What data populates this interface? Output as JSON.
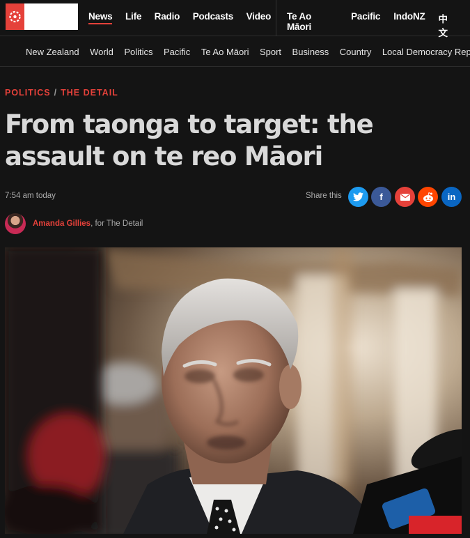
{
  "primary_nav": [
    {
      "label": "News"
    },
    {
      "label": "Life"
    },
    {
      "label": "Radio"
    },
    {
      "label": "Podcasts"
    },
    {
      "label": "Video"
    }
  ],
  "secondary_nav": [
    {
      "label": "Te Ao Māori"
    },
    {
      "label": "Pacific"
    },
    {
      "label": "IndoNZ"
    },
    {
      "label": "中文"
    }
  ],
  "section_nav": [
    {
      "label": "New Zealand"
    },
    {
      "label": "World"
    },
    {
      "label": "Politics"
    },
    {
      "label": "Pacific"
    },
    {
      "label": "Te Ao Māori"
    },
    {
      "label": "Sport"
    },
    {
      "label": "Business"
    },
    {
      "label": "Country"
    },
    {
      "label": "Local Democracy Rep"
    }
  ],
  "article": {
    "kicker_1": "POLITICS",
    "kicker_sep": "/",
    "kicker_2": "THE DETAIL",
    "headline": "From taonga to target: the assault on te reo Māori",
    "timestamp": "7:54 am today",
    "share_label": "Share this",
    "author": "Amanda Gillies",
    "affiliation": ", for The Detail"
  },
  "share_buttons": [
    {
      "icon": "twitter-icon",
      "glyph": "🐦"
    },
    {
      "icon": "facebook-icon",
      "glyph": "f"
    },
    {
      "icon": "email-icon",
      "glyph": "✉"
    },
    {
      "icon": "reddit-icon",
      "glyph": "●"
    },
    {
      "icon": "linkedin-icon",
      "glyph": "in"
    }
  ],
  "colors": {
    "accent": "#e5413a",
    "background": "#141414",
    "headline": "#d9d9d9"
  }
}
